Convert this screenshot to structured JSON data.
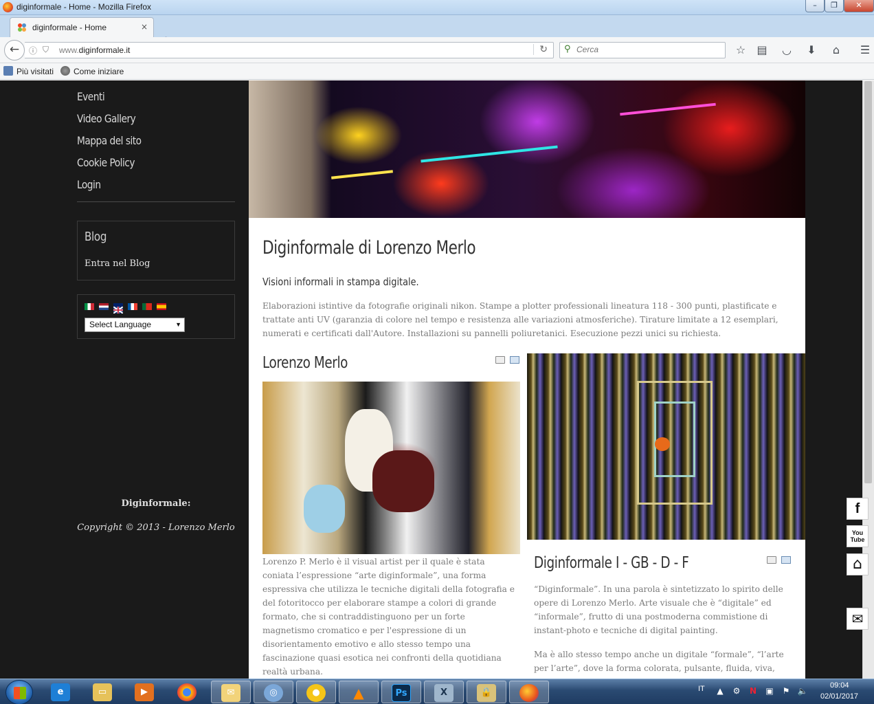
{
  "window": {
    "title": "diginformale - Home - Mozilla Firefox",
    "minimize_glyph": "–",
    "maximize_glyph": "❐",
    "close_glyph": "✕"
  },
  "tabs": [
    {
      "label": "diginformale - Home",
      "close_glyph": "×"
    }
  ],
  "new_tab_glyph": "+",
  "navbar": {
    "back_glyph": "←",
    "url_dim": "www.",
    "url_main": "diginformale.it",
    "reload_glyph": "↻",
    "search_placeholder": "Cerca"
  },
  "bookmarks": [
    {
      "label": "Più visitati",
      "icon": "most-visited-icon"
    },
    {
      "label": "Come iniziare",
      "icon": "getting-started-icon"
    }
  ],
  "sidebar": {
    "menu": [
      "Eventi",
      "Video Gallery",
      "Mappa del sito",
      "Cookie Policy",
      "Login"
    ],
    "blog": {
      "title": "Blog",
      "link": "Entra nel Blog"
    },
    "language": {
      "selected": "Select Language",
      "flags": [
        "italian-flag",
        "dutch-flag",
        "english-flag",
        "french-flag",
        "portuguese-flag",
        "spanish-flag"
      ]
    },
    "footer": {
      "name": "Diginformale:",
      "copyright": "Copyright © 2013 - Lorenzo Merlo"
    }
  },
  "content": {
    "title": "Diginformale di Lorenzo Merlo",
    "subtitle": "Visioni informali in stampa digitale.",
    "intro": "Elaborazioni istintive da fotografie originali nikon. Stampe a plotter professionali lineatura 118 - 300 punti, plastificate e trattate anti UV (garanzia di colore nel tempo e resistenza alle variazioni atmosferiche). Tirature limitate a 12 esemplari, numerati e certificati dall'Autore. Installazioni su pannelli poliuretanici. Esecuzione pezzi unici su richiesta.",
    "articles": [
      {
        "title": "Lorenzo Merlo",
        "text": "Lorenzo P. Merlo è il visual artist per il quale è stata coniata l’espressione “arte diginformale”, una forma espressiva che utilizza le tecniche digitali della fotografia e del fotoritocco per elaborare stampe a colori di grande formato, che si contraddistinguono per un forte magnetismo cromatico e per l'espressione di un disorientamento emotivo e allo stesso tempo una fascinazione quasi esotica nei confronti della quotidiana realtà urbana."
      },
      {
        "title": "Diginformale I - GB - D - F",
        "text": "“Diginformale”. In una parola è sintetizzato lo spirito delle opere di Lorenzo Merlo. Arte visuale che è “digitale” ed “informale”, frutto di una postmoderna commistione di instant-photo e tecniche di digital painting.",
        "text2": "Ma è allo stesso tempo anche un digitale “formale”, “l’arte per l’arte”, dove la forma colorata, pulsante, fluida, viva,"
      }
    ]
  },
  "social": [
    {
      "name": "facebook",
      "glyph": "f"
    },
    {
      "name": "youtube",
      "glyph": "You Tube"
    },
    {
      "name": "home",
      "glyph": "⌂"
    },
    {
      "name": "email",
      "glyph": "✉"
    }
  ],
  "taskbar": {
    "apps": [
      "internet-explorer",
      "file-explorer",
      "media-player",
      "chrome",
      "outlook",
      "network",
      "notes",
      "vlc",
      "photoshop",
      "app-x",
      "security",
      "firefox"
    ],
    "tray": {
      "language": "IT",
      "time": "09:04",
      "date": "02/01/2017"
    }
  },
  "colors": {
    "sidebar_bg": "#1a1a1a",
    "content_bg": "#ffffff",
    "title_text": "#333333",
    "body_text": "#7a7a7a"
  }
}
